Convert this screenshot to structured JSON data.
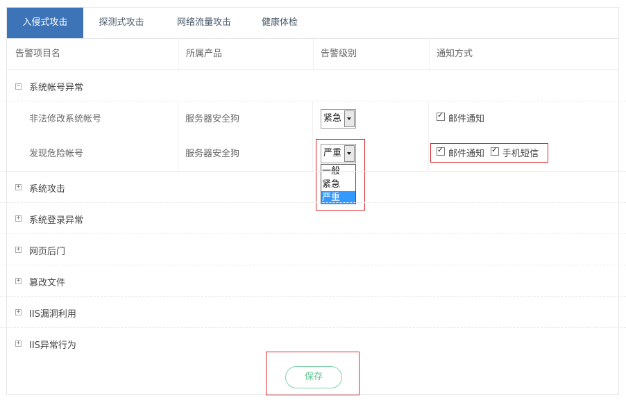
{
  "tabs": [
    "入侵式攻击",
    "探测式攻击",
    "网络流量攻击",
    "健康体检"
  ],
  "columns": [
    "告警项目名",
    "所属产品",
    "告警级别",
    "通知方式"
  ],
  "expanded_group": {
    "toggle": "−",
    "label": "系统帐号异常",
    "items": [
      {
        "name": "非法修改系统帐号",
        "product": "服务器安全狗",
        "level": "紧急",
        "notify": [
          {
            "label": "邮件通知",
            "checked": true
          }
        ]
      },
      {
        "name": "发现危险帐号",
        "product": "服务器安全狗",
        "level": "严重",
        "notify": [
          {
            "label": "邮件通知",
            "checked": true
          },
          {
            "label": "手机短信",
            "checked": true
          }
        ]
      }
    ]
  },
  "dropdown": {
    "options": [
      "一般",
      "紧急",
      "严重"
    ],
    "selected": "严重"
  },
  "collapsed_groups": [
    {
      "toggle": "+",
      "label": "系统攻击"
    },
    {
      "toggle": "+",
      "label": "系统登录异常"
    },
    {
      "toggle": "+",
      "label": "网页后门"
    },
    {
      "toggle": "+",
      "label": "篡改文件"
    },
    {
      "toggle": "+",
      "label": "IIS漏洞利用"
    },
    {
      "toggle": "+",
      "label": "IIS异常行为"
    }
  ],
  "save_label": "保存",
  "colors": {
    "tab_active": "#3d74b8",
    "highlight": "#d9292b",
    "save_green": "#5fc48f",
    "option_selected": "#3399ff"
  }
}
